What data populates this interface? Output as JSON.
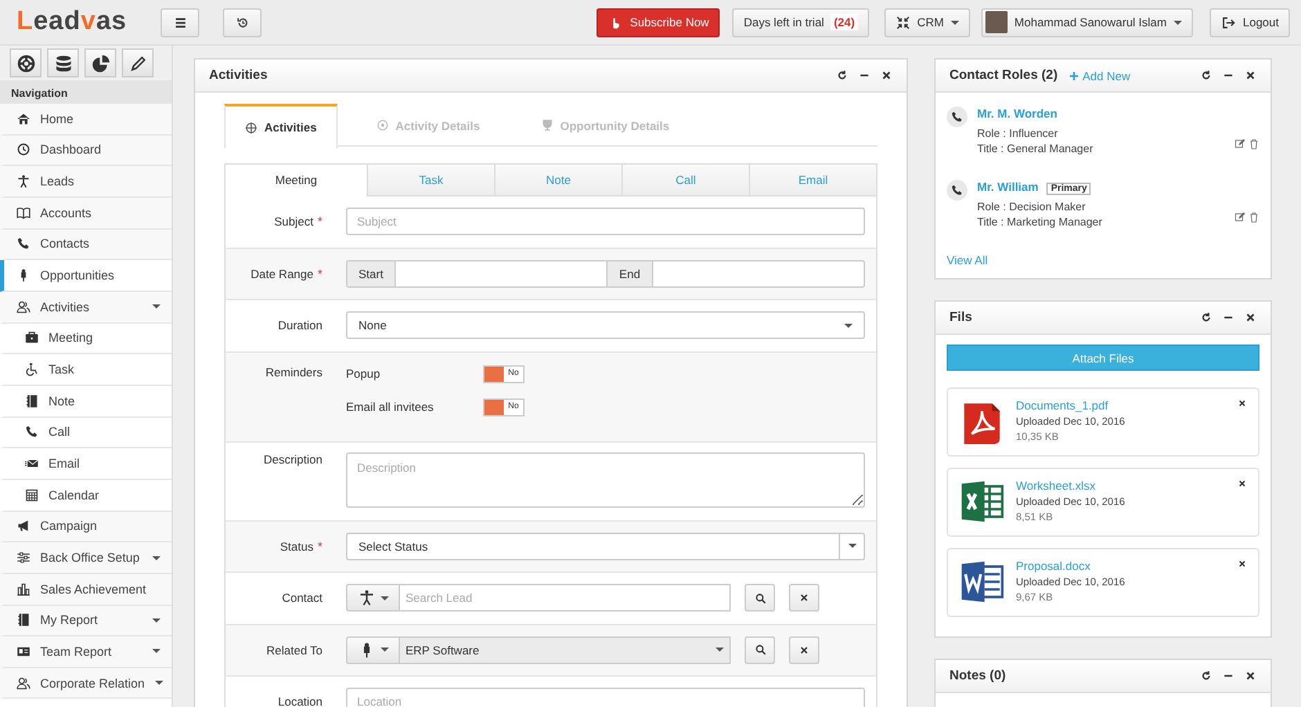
{
  "topbar": {
    "logo": [
      {
        "text": "L",
        "accent": true
      },
      {
        "text": "ead",
        "accent": false
      },
      {
        "text": "v",
        "accent": true
      },
      {
        "text": "as",
        "accent": false
      }
    ],
    "subscribe": "Subscribe Now",
    "trial": {
      "label": "Days left in trial",
      "count": "(24)"
    },
    "module": "CRM",
    "user": "Mohammad Sanowarul Islam",
    "logout": "Logout"
  },
  "sidebar": {
    "heading": "Navigation",
    "items": [
      {
        "label": "Home",
        "selected": false
      },
      {
        "label": "Dashboard",
        "selected": false
      },
      {
        "label": "Leads",
        "selected": false
      },
      {
        "label": "Accounts",
        "selected": false
      },
      {
        "label": "Contacts",
        "selected": false
      },
      {
        "label": "Opportunities",
        "selected": true
      },
      {
        "label": "Activities",
        "selected": false,
        "submenu": true,
        "children": [
          {
            "label": "Meeting",
            "selected": false
          },
          {
            "label": "Task",
            "selected": false
          },
          {
            "label": "Note",
            "selected": false
          },
          {
            "label": "Call",
            "selected": false
          },
          {
            "label": "Email",
            "selected": false
          },
          {
            "label": "Calendar",
            "selected": false
          }
        ]
      },
      {
        "label": "Campaign",
        "selected": false
      },
      {
        "label": "Back Office Setup",
        "selected": false,
        "submenu": true
      },
      {
        "label": "Sales Achievement",
        "selected": false
      },
      {
        "label": "My Report",
        "selected": false,
        "submenu": true
      },
      {
        "label": "Team Report",
        "selected": false,
        "submenu": true
      },
      {
        "label": "Corporate Relation",
        "selected": false,
        "submenu": true
      }
    ]
  },
  "activities": {
    "title": "Activities",
    "tabs": [
      {
        "label": "Activities",
        "selected": true,
        "disabled": false
      },
      {
        "label": "Activity Details",
        "selected": false,
        "disabled": true
      },
      {
        "label": "Opportunity Details",
        "selected": false,
        "disabled": true
      }
    ],
    "subtabs": [
      {
        "label": "Meeting",
        "selected": true
      },
      {
        "label": "Task",
        "selected": false
      },
      {
        "label": "Note",
        "selected": false
      },
      {
        "label": "Call",
        "selected": false
      },
      {
        "label": "Email",
        "selected": false
      }
    ],
    "rows": [
      {
        "kind": "text",
        "label": "Subject",
        "required_mark": "*",
        "placeholder": "Subject"
      },
      {
        "kind": "daterange",
        "label": "Date Range",
        "required_mark": "*",
        "start": "Start",
        "end": "End"
      },
      {
        "kind": "select",
        "label": "Duration",
        "value": "None"
      },
      {
        "kind": "reminders",
        "label": "Reminders",
        "options": [
          {
            "label": "Popup",
            "on": false,
            "state": "No"
          },
          {
            "label": "Email all invitees",
            "on": false,
            "state": "No"
          }
        ]
      },
      {
        "kind": "textarea",
        "label": "Description",
        "placeholder": "Description"
      },
      {
        "kind": "combo",
        "label": "Status",
        "required_mark": "*",
        "value": "Select Status"
      },
      {
        "kind": "lookup",
        "label": "Contact",
        "placeholder": "Search Lead"
      },
      {
        "kind": "related",
        "label": "Related To",
        "value": "ERP Software"
      },
      {
        "kind": "text",
        "label": "Location",
        "placeholder": "Location"
      }
    ]
  },
  "contact_roles": {
    "title": "Contact Roles (2)",
    "add": "Add New",
    "contacts": [
      {
        "name": "Mr. M. Worden",
        "role": "Role : Influencer",
        "position": "Title : General Manager"
      },
      {
        "name": "Mr. William",
        "badge": "Primary",
        "role": "Role : Decision Maker",
        "position": "Title : Marketing Manager"
      }
    ],
    "view_all": "View All"
  },
  "files": {
    "title": "Fils",
    "button": "Attach Files",
    "items": [
      {
        "kind": "pdf",
        "name": "Documents_1.pdf",
        "uploaded": "Uploaded Dec 10, 2016",
        "size": "10,35 KB"
      },
      {
        "kind": "xlsx",
        "name": "Worksheet.xlsx",
        "uploaded": "Uploaded Dec 10, 2016",
        "size": "8,51 KB"
      },
      {
        "kind": "docx",
        "name": "Proposal.docx",
        "uploaded": "Uploaded Dec 10, 2016",
        "size": "9,67 KB"
      }
    ]
  },
  "notes": {
    "title": "Notes (0)"
  }
}
